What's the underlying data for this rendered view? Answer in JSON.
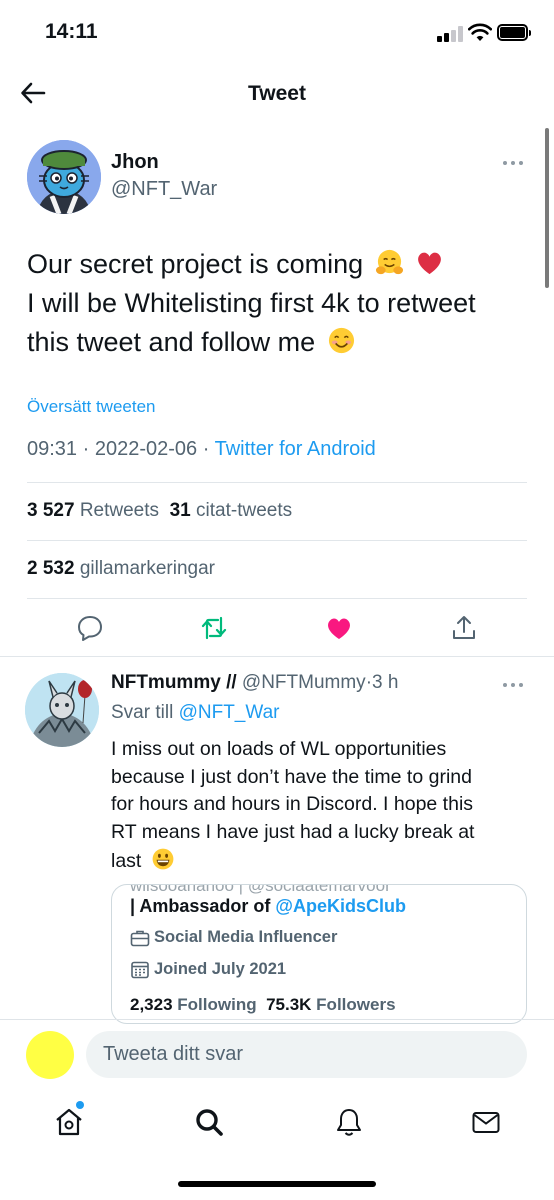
{
  "status_bar": {
    "time": "14:11"
  },
  "header": {
    "title": "Tweet"
  },
  "tweet": {
    "author_name": "Jhon",
    "author_handle": "@NFT_War",
    "text_lines": [
      "Our secret project is coming",
      "I will be Whitelisting first 4k to retweet",
      "this tweet and follow me"
    ],
    "emojis": [
      "hugging-face",
      "red-heart",
      "smiling-face"
    ],
    "translate_label": "Översätt tweeten",
    "time": "09:31",
    "date": "2022-02-06",
    "source": "Twitter for Android",
    "separator": "·",
    "retweets_count": "3 527",
    "retweets_label": "Retweets",
    "quotes_count": "31",
    "quotes_label": "citat-tweets",
    "likes_count": "2 532",
    "likes_label": "gillamarkeringar",
    "liked": true
  },
  "reply": {
    "author_name": "NFTmummy //",
    "author_handle": "@NFTMummy",
    "age": "3 h",
    "reply_to_label": "Svar till",
    "reply_to_handle": "@NFT_War",
    "text_lines": [
      "I miss out on loads of WL opportunities",
      "because I just don’t have the time to grind",
      "for hours and hours in Discord. I hope this",
      "RT means I have just had a lucky break at",
      "last"
    ],
    "emoji": "grinning-face",
    "card": {
      "cut_text": "wilsooarianoo | @sociaatemarvoor",
      "ambassador_prefix": "| Ambassador of",
      "ambassador_handle": "@ApeKidsClub",
      "occupation": "Social Media Influencer",
      "joined": "Joined July 2021",
      "following_count": "2,323",
      "following_label": "Following",
      "followers_count": "75.3K",
      "followers_label": "Followers"
    }
  },
  "composer": {
    "placeholder": "Tweeta ditt svar"
  },
  "colors": {
    "accent": "#1d9bf0",
    "like": "#f91880",
    "retweet": "#00ba7c",
    "secondary_text": "#536471"
  },
  "icons": [
    "back-arrow-icon",
    "more-icon",
    "reply-icon",
    "retweet-icon",
    "like-icon",
    "share-icon",
    "home-icon",
    "search-icon",
    "notifications-icon",
    "messages-icon"
  ]
}
